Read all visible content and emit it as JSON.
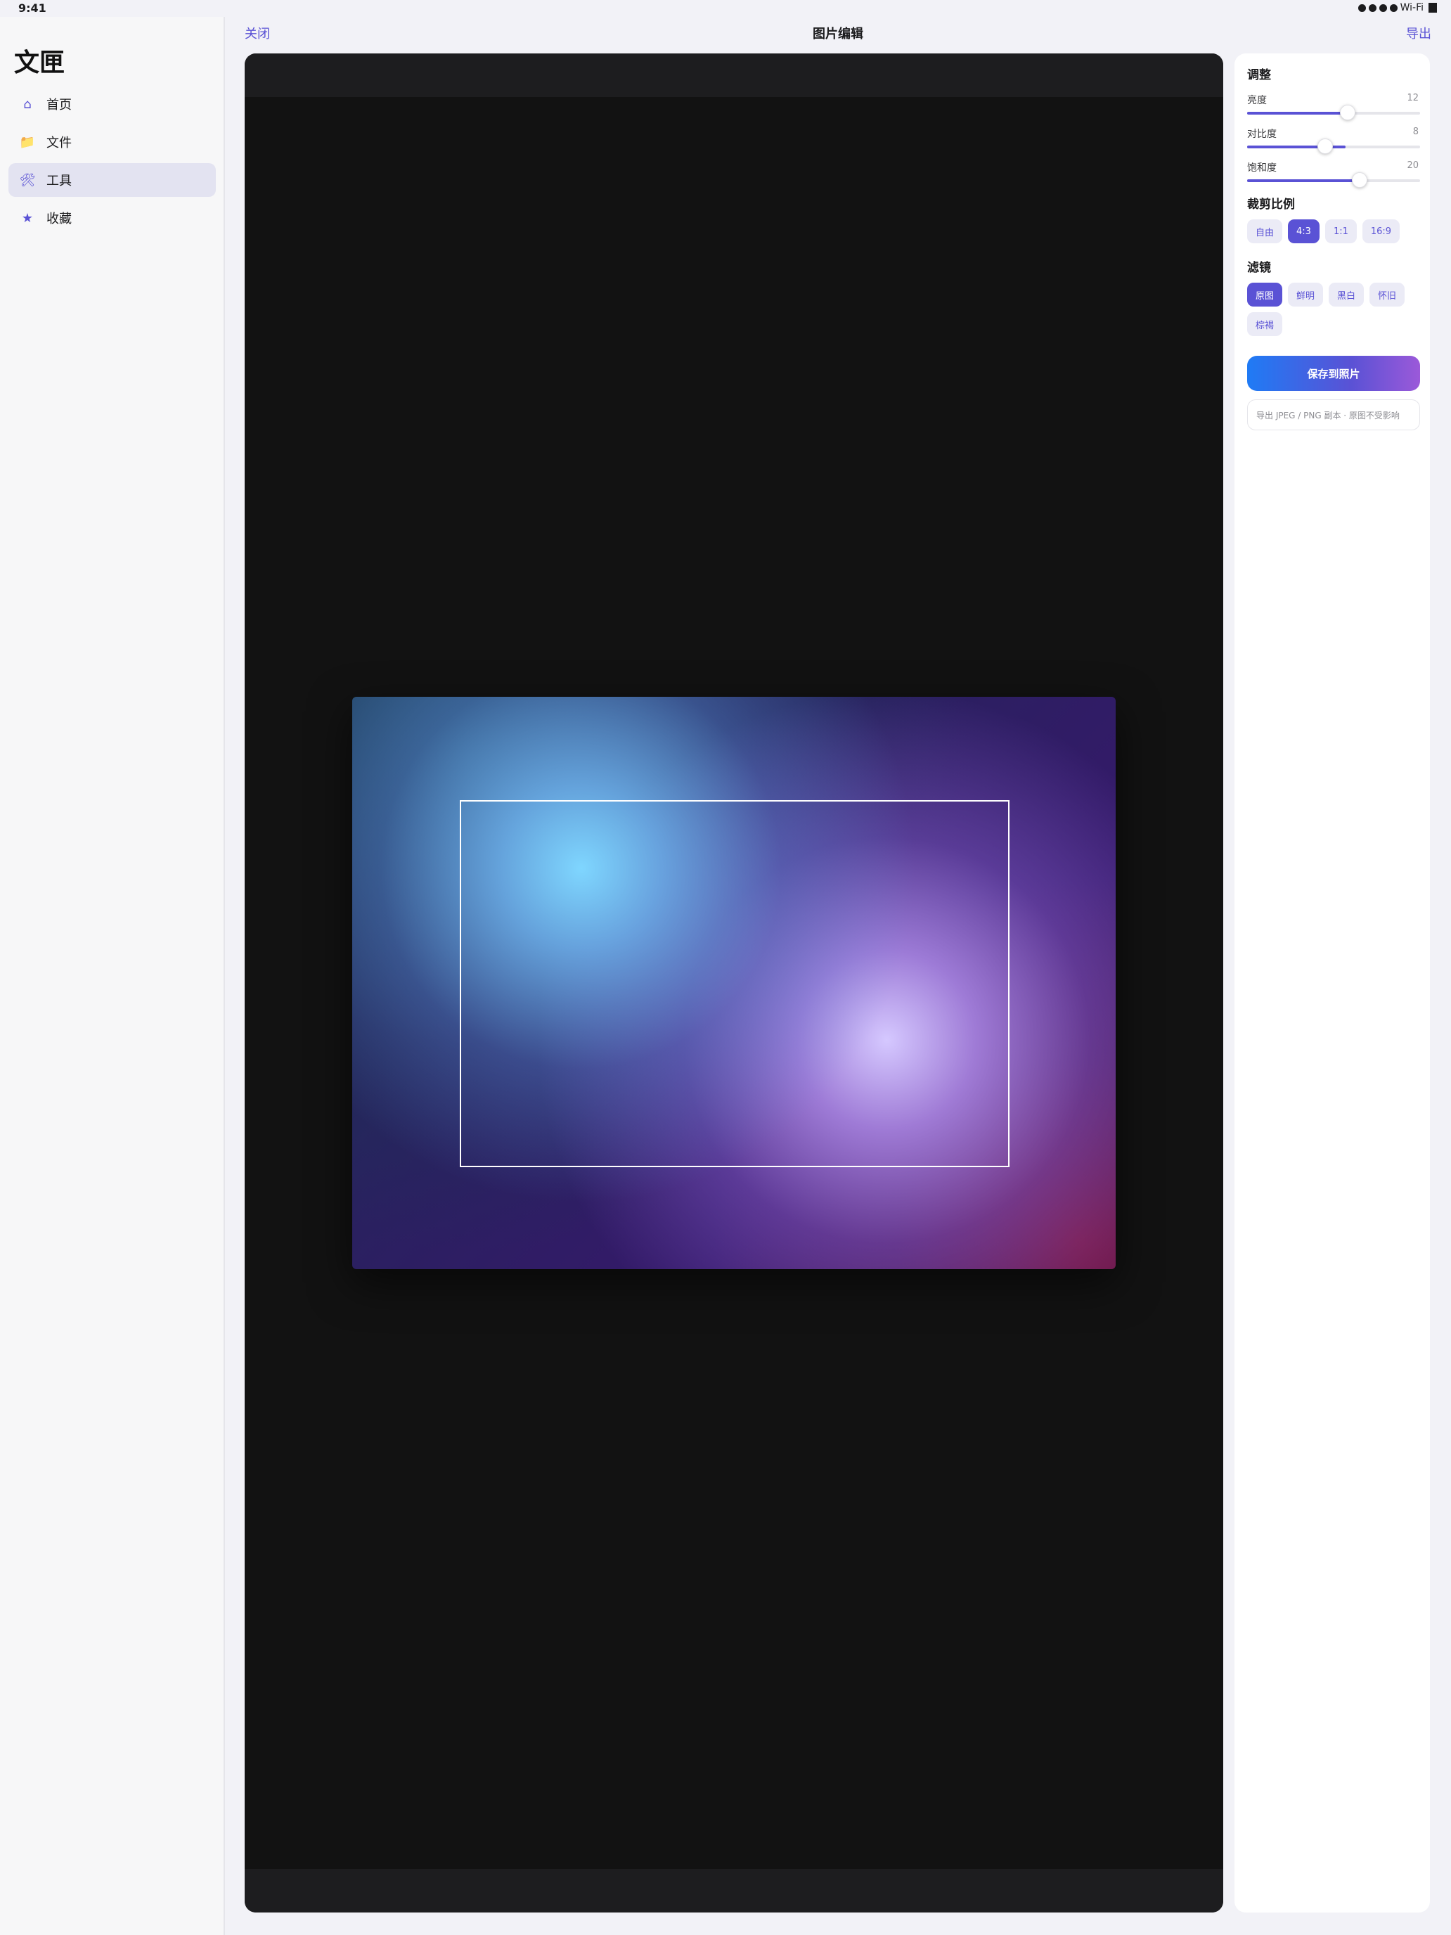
{
  "status_bar": {
    "time": "9:41",
    "network": "Wi-Fi"
  },
  "sidebar": {
    "app_title": "文匣",
    "items": [
      {
        "label": "首页",
        "icon": "home-icon",
        "glyph": "⌂"
      },
      {
        "label": "文件",
        "icon": "folder-icon",
        "glyph": "📁"
      },
      {
        "label": "工具",
        "icon": "tools-icon",
        "glyph": "🛠"
      },
      {
        "label": "收藏",
        "icon": "star-icon",
        "glyph": "★"
      }
    ],
    "active_item": "工具"
  },
  "topbar": {
    "close_label": "关闭",
    "title": "图片编辑",
    "export_label": "导出"
  },
  "panel": {
    "adjust_title": "调整",
    "sliders": [
      {
        "label": "亮度",
        "value": "12",
        "fraction": 0.58
      },
      {
        "label": "对比度",
        "value": "8",
        "fraction": 0.45
      },
      {
        "label": "饱和度",
        "value": "20",
        "fraction": 0.65
      }
    ],
    "crop_title": "裁剪比例",
    "crop_options": [
      "自由",
      "4:3",
      "1:1",
      "16:9"
    ],
    "crop_selected": "4:3",
    "filter_title": "滤镜",
    "filter_options": [
      "原图",
      "鲜明",
      "黑白",
      "怀旧",
      "棕褐"
    ],
    "filter_selected": "原图",
    "save_label": "保存到照片",
    "save_note": "导出 JPEG / PNG 副本 · 原图不受影响"
  },
  "colors": {
    "accent": "#5a52d5",
    "canvas": "#121212"
  }
}
